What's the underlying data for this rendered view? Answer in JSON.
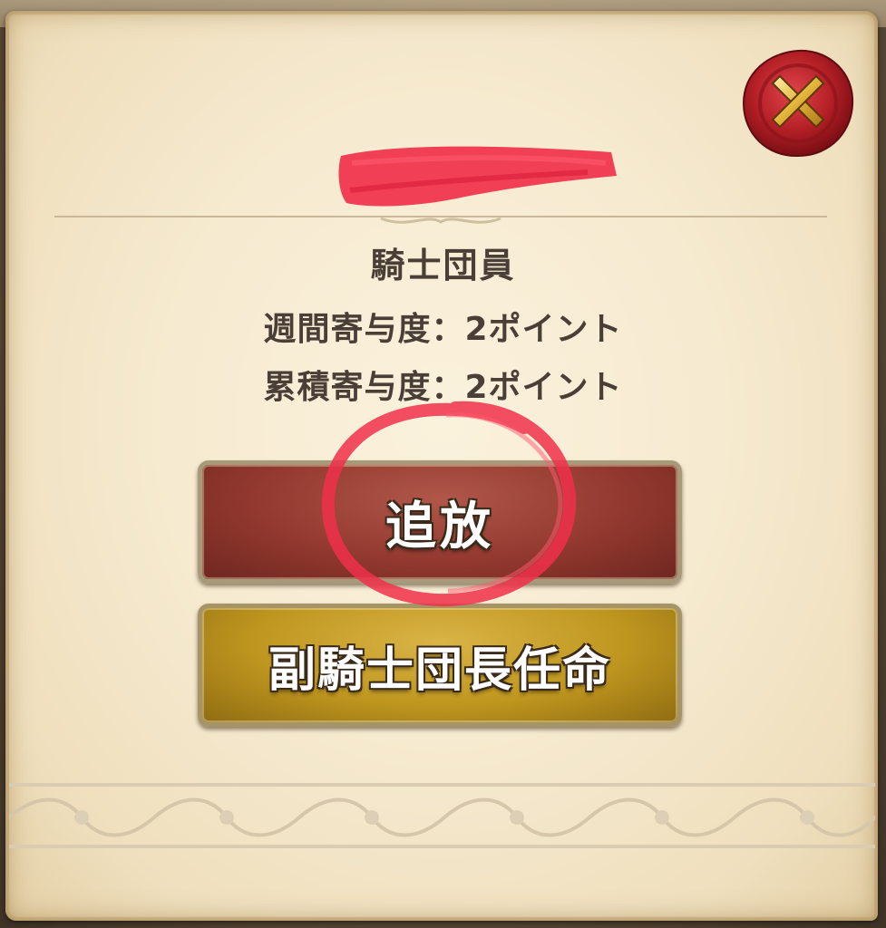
{
  "dialog": {
    "close_icon": "close-seal-icon",
    "member_name_redacted": true,
    "role": "騎士団員",
    "weekly_contribution": "週間寄与度：2ポイント",
    "total_contribution": "累積寄与度：2ポイント"
  },
  "actions": {
    "expel_label": "追放",
    "appoint_label": "副騎士団長任命"
  },
  "colors": {
    "parchment": "#f6ead0",
    "text": "#4a3f36",
    "expel_button": "#93392f",
    "appoint_button": "#bf961f",
    "seal": "#b41f26",
    "annotation": "#f0304a"
  }
}
